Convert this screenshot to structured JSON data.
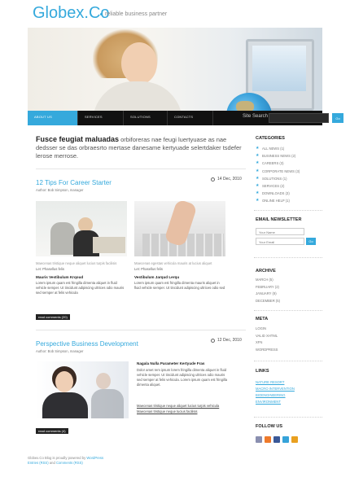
{
  "header": {
    "logo_main": "Globex",
    "logo_dot": ".",
    "logo_tail": "Co",
    "tagline": "reliable business partner"
  },
  "nav": {
    "items": [
      "About us",
      "Services",
      "Solutions",
      "Contacts"
    ],
    "search_label": "Site Search",
    "search_button": "Go"
  },
  "intro": {
    "bold": "Fusce feugiat maluadas",
    "text": "orbiforeras nae feugi luertyuase as nae dedsser se das orbraesrto mertase danesame kertyuade selertdaker tsdefer lerose merrose."
  },
  "posts": [
    {
      "title": "12 Tips For Career Starter",
      "author": "Author: Bob Simpson, manager",
      "date": "14 Dec, 2010",
      "col1": {
        "caption": "Maecenas tristique neque aliquet lucius turpis facilisis",
        "link": "Let: Phasellus felis",
        "heading": "Mauris Vestibulum Krqoud",
        "text": "Lorem ipsum quam est fringilla dimenta aliquet in fluid vehicle semper. Ut tincidunt adipiscing ultrices odio mauris sed semper at felis vehicula"
      },
      "col2": {
        "caption": "Maecenas egestas vehicula mauris at lucius aliquet",
        "link": "Let: Phasellus felis",
        "heading": "Vestibulum Jarqud Lerqu",
        "text": "Lorem ipsum quam est fringilla dimenta mauris aliquet in fluid vehicle semper. Ut tincidunt adipiscing ultrices odio sed"
      },
      "read_more": "read comments (20)"
    },
    {
      "title": "Perspective Business Development",
      "author": "Author: Bob Simpson, manager",
      "date": "12 Dec, 2010",
      "heading": "Nagala Nulla Parameter Kertyude Fras",
      "text": "Dolor amet rem ipsum lorem fringilla dimenta aliquet in fluid vehicle semper. Ut tincidunt adipiscing ultrices odio mauris sed semper at felis vehicula. Lorem ipsum quam est fringilla dimenta aliquet.",
      "link1": "Maecenas tristique neque aliquet lucius turpis vehicula",
      "link2": "Maecenas tristique neque lucius facilisis",
      "read_more": "read comments (4)"
    }
  ],
  "sidebar": {
    "categories_title": "Categories",
    "categories": [
      "All news (1)",
      "Business news (2)",
      "Careers (3)",
      "Corporate news (3)",
      "Solutions (1)",
      "Services (2)",
      "Downloads (3)",
      "Online help (1)"
    ],
    "newsletter_title": "Email Newsletter",
    "newsletter_name_placeholder": "Your Name",
    "newsletter_email_placeholder": "Your Email",
    "newsletter_button": "Go",
    "archive_title": "Archive",
    "archive": [
      "March (5)",
      "February (2)",
      "January (9)",
      "December (5)"
    ],
    "meta_title": "Meta",
    "meta": [
      "Login",
      "Valid XHTML",
      "XFN",
      "WordPress"
    ],
    "links_title": "Links",
    "links": [
      "Nature Resort",
      "Macro Intervention",
      "Bioengineering",
      "Environment"
    ],
    "follow_title": "Follow Us",
    "social": [
      {
        "icon": "social-icon",
        "color": "#8a8fb0"
      },
      {
        "icon": "social-icon",
        "color": "#ee7a2b"
      },
      {
        "icon": "social-icon",
        "color": "#3b5998"
      },
      {
        "icon": "social-icon",
        "color": "#36a3d9"
      },
      {
        "icon": "social-icon",
        "color": "#e9a020"
      }
    ]
  },
  "footer": {
    "line1": "Globex.Co Blog is proudly powered by",
    "line1_link": "WordPress",
    "line2_a": "Entries (RSS)",
    "line2_mid": "and",
    "line2_b": "Comments (RSS)"
  },
  "colors": {
    "accent": "#35a9dc",
    "nav_bg": "#111111"
  }
}
